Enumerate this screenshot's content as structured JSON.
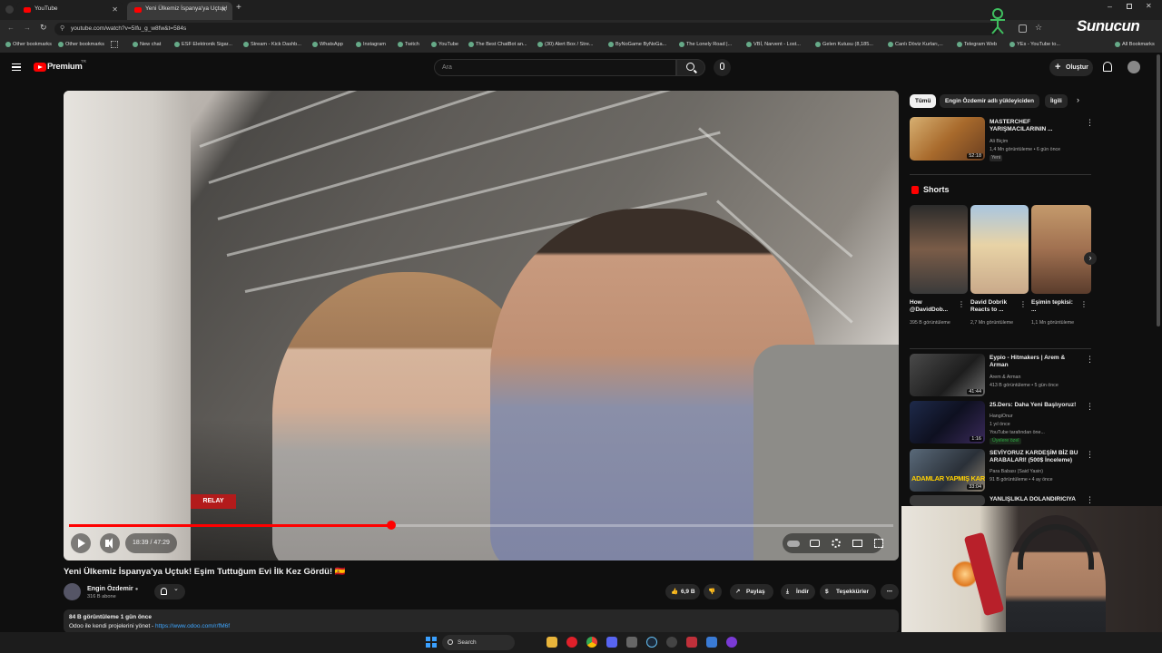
{
  "browser": {
    "tabs": [
      {
        "title": "YouTube"
      },
      {
        "title": "Yeni Ülkemiz İspanya'ya Uçtuk!"
      }
    ],
    "url": "youtube.com/watch?v=5Ifu_g_w8fw&t=584s",
    "bookmarks": [
      "Other bookmarks",
      "Other bookmarks",
      "New chat",
      "ESF Elektronik Sigar...",
      "Stream - Kick Dashb...",
      "WhatsApp",
      "Instagram",
      "Twitch",
      "YouTube",
      "The Best ChatBot an...",
      "(30) Alert Box / Stre...",
      "ByNoGame ByNoGa...",
      "The Lonely Road |...",
      "VBİ, Narvent - Lost...",
      "Gelen Kutusu (8,185...",
      "Canlı Döviz Kurları,...",
      "Telegram Web",
      "YEs - YouTube to...",
      "All Bookmarks"
    ]
  },
  "header": {
    "logo_text": "Premium",
    "logo_sup": "TR",
    "search_placeholder": "Ara",
    "create_label": "Oluştur"
  },
  "player": {
    "progress_fraction": 0.391,
    "time_current": "18:39",
    "time_total": "47:29",
    "relay_sign": "RELAY"
  },
  "video": {
    "title": "Yeni Ülkemiz İspanya'ya Uçtuk! Eşim Tuttuğum Evi İlk Kez Gördü! 🇪🇸",
    "channel": "Engin Özdemir",
    "subscribers": "316 B abone",
    "likes": "6,9 B",
    "share_label": "Paylaş",
    "download_label": "İndir",
    "thanks_label": "Teşekkürler",
    "views_line": "84 B görüntüleme  1 gün önce",
    "desc_line": "Odoo ile kendi projelerini yönet -",
    "desc_link": "https://www.odoo.com/r/fM6f"
  },
  "sidebar": {
    "chips": [
      "Tümü",
      "Engin Özdemir adlı yükleyiciden",
      "İlgili"
    ],
    "top_video": {
      "title": "MASTERCHEF YARIŞMACILARININ ...",
      "channel": "Ali Biçim",
      "meta": "1,4 Mn görüntüleme • 6 gün önce",
      "badge": "Yeni",
      "duration": "52:18"
    },
    "shorts_heading": "Shorts",
    "shorts": [
      {
        "title": "How @DavidDob...",
        "views": "395 B görüntüleme"
      },
      {
        "title": "David Dobrik Reacts to ...",
        "views": "2,7 Mn görüntüleme"
      },
      {
        "title": "Eşimin tepkisi: ...",
        "views": "1,1 Mn görüntüleme"
      }
    ],
    "videos": [
      {
        "title": "Eypio - Hitmakers | Arem & Arman",
        "channel": "Arem & Arman",
        "meta": "413 B görüntüleme • 5 gün önce",
        "duration": "41:44"
      },
      {
        "title": "25.Ders: Daha Yeni Başlıyoruz!",
        "channel": "HangiOnur",
        "meta": "1 yıl önce",
        "extra": "YouTube tarafından öne...",
        "badge": "Üyelere özel",
        "duration": "1:16"
      },
      {
        "title": "SEVİYORUZ KARDEŞİM BİZ BU ARABALARI! (500$ İnceleme)",
        "channel": "Para Babası (Said Yasin)",
        "meta": "91 B görüntüleme • 4 ay önce",
        "duration": "33:04",
        "thumb_text": "ADAMLAR YAPMIŞ KARDE"
      },
      {
        "title": "YANLIŞLIKLA DOLANDIRICIYA",
        "channel": "",
        "meta": ""
      }
    ]
  },
  "overlay": {
    "brand": "Sunucun"
  },
  "taskbar": {
    "search_label": "Search"
  },
  "colors": {
    "accent": "#ff0000",
    "background": "#0f0f0f",
    "surface": "#272727",
    "text_secondary": "#aaaaaa",
    "link": "#3ea6ff"
  }
}
